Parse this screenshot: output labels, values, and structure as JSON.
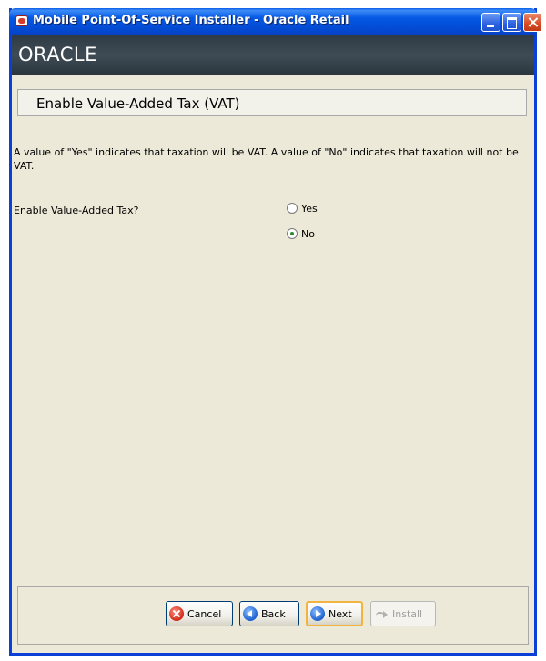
{
  "window": {
    "title": "Mobile Point-Of-Service Installer - Oracle Retail",
    "app_icon": "oracle-retail-icon",
    "controls": {
      "minimize": "minimize-icon",
      "maximize": "maximize-icon",
      "close": "close-icon"
    }
  },
  "banner": {
    "logo_text": "ORACLE"
  },
  "page": {
    "heading": "Enable Value-Added Tax (VAT)",
    "description": "A value of \"Yes\" indicates that taxation will be VAT.  A value of \"No\" indicates that taxation will not be VAT.",
    "field_label": "Enable Value-Added Tax?",
    "options": [
      {
        "label": "Yes",
        "selected": false
      },
      {
        "label": "No",
        "selected": true
      }
    ]
  },
  "footer": {
    "buttons": [
      {
        "label": "Cancel",
        "icon": "cancel-icon",
        "enabled": true
      },
      {
        "label": "Back",
        "icon": "back-arrow-icon",
        "enabled": true
      },
      {
        "label": "Next",
        "icon": "next-arrow-icon",
        "enabled": true,
        "default": true
      },
      {
        "label": "Install",
        "icon": "install-arrow-icon",
        "enabled": false
      }
    ]
  },
  "colors": {
    "titlebar_blue": "#0559e4",
    "banner_dark": "#3f4c55",
    "window_bg": "#ece9d8",
    "default_button_focus": "#f3b33f"
  }
}
